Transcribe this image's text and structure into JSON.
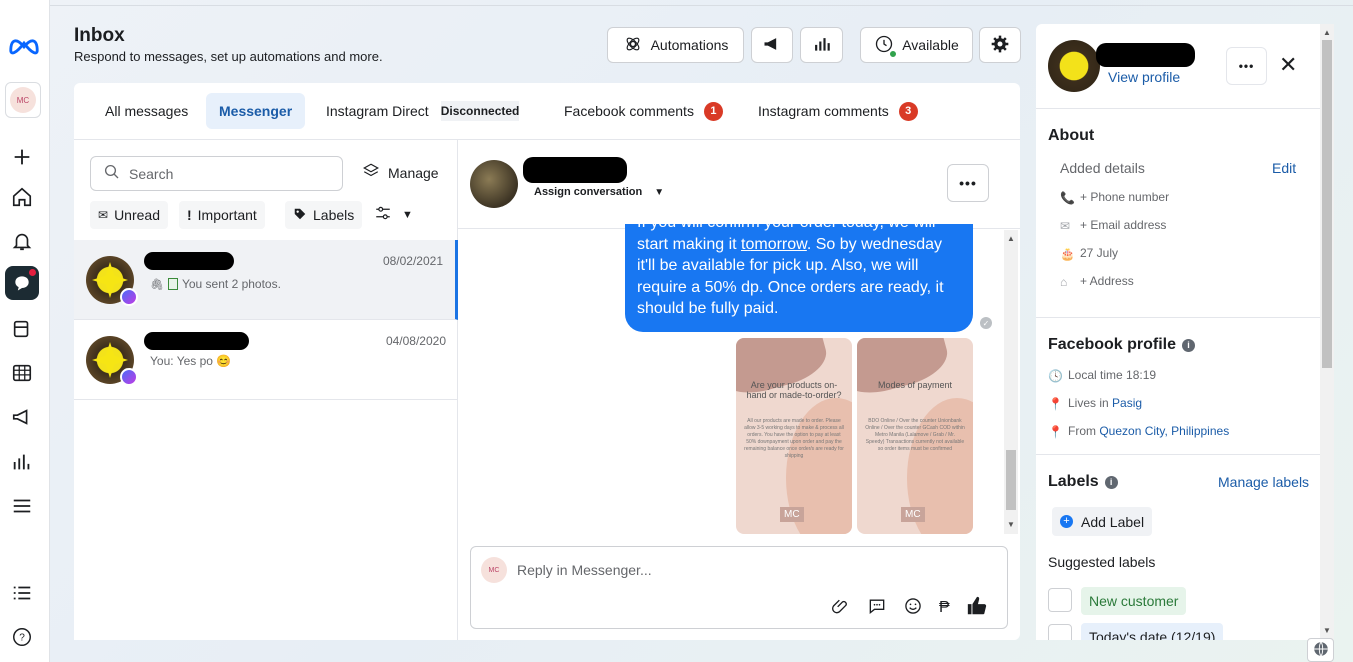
{
  "header": {
    "title": "Inbox",
    "subtitle": "Respond to messages, set up automations and more."
  },
  "toolbar": {
    "automations_label": "Automations",
    "available_label": "Available"
  },
  "tabs": {
    "all": "All messages",
    "messenger": "Messenger",
    "instagram_direct": "Instagram Direct",
    "disconnected": "Disconnected",
    "facebook_comments": "Facebook comments",
    "facebook_comments_count": "1",
    "instagram_comments": "Instagram comments",
    "instagram_comments_count": "3"
  },
  "list": {
    "search_placeholder": "Search",
    "manage_label": "Manage",
    "filters": {
      "unread": "Unread",
      "important": "Important",
      "labels": "Labels"
    },
    "conversations": [
      {
        "date": "08/02/2021",
        "preview": "You sent 2 photos."
      },
      {
        "date": "04/08/2020",
        "preview": "You: Yes po 😊"
      }
    ]
  },
  "chat": {
    "assign_label": "Assign conversation",
    "message_line0": "If you will confirm your order today, we will",
    "message_line1_a": "start making it ",
    "message_line1_link": "tomorrow",
    "message_line1_b": ". So by wednesday",
    "message_line2": "it'll be available for pick up. Also, we will",
    "message_line3": "require a 50% dp. Once orders are ready, it",
    "message_line4": "should be fully paid.",
    "image1_title": "Are your products on-hand or made-to-order?",
    "image1_body": "All our products are made to order. Please allow 3-5 working days to make & process all orders. You have the option to pay at least 50% downpayment upon order and pay the remaining balance once order/s are ready for shipping",
    "image2_title": "Modes of payment",
    "image2_body": "BDO Online / Over the counter Unionbank Online / Over the counter GCash COD within Metro Manila (Lalamove / Grab / Mr. Speedy) Transactions currently not available so order items must be confirmed",
    "image_logo": "MC",
    "reply_placeholder": "Reply in Messenger..."
  },
  "side": {
    "view_profile": "View profile",
    "about_title": "About",
    "added_details": "Added details",
    "edit": "Edit",
    "phone": "+ Phone number",
    "email": "+ Email address",
    "birthday": "27 July",
    "address": "+ Address",
    "fb_profile_title": "Facebook profile",
    "local_time": "Local time 18:19",
    "lives_prefix": "Lives in ",
    "lives_city": "Pasig",
    "from_prefix": "From ",
    "from_city": "Quezon City, Philippines",
    "labels_title": "Labels",
    "manage_labels": "Manage labels",
    "add_label": "Add Label",
    "suggested_labels": "Suggested labels",
    "label_new_customer": "New customer",
    "label_todays_date": "Today's date (12/19)"
  },
  "colors": {
    "accent": "#1877f2",
    "badge": "#d93a26",
    "active_tab_bg": "#e7f0fb"
  }
}
